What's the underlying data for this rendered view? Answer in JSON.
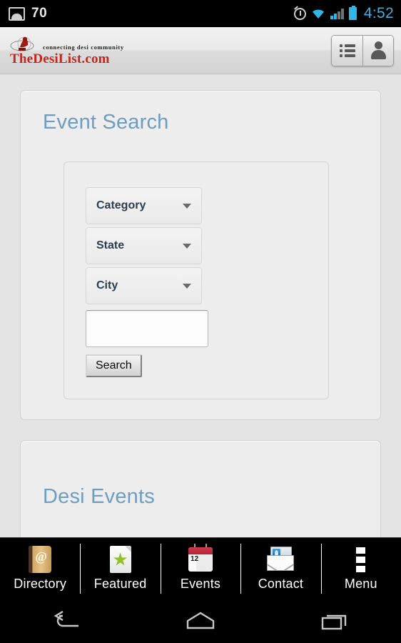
{
  "statusbar": {
    "notification_icon": "picture-icon",
    "notification_count": "70",
    "icons": [
      "alarm-icon",
      "wifi-icon",
      "signal-icon",
      "battery-icon"
    ],
    "time": "4:52",
    "accent_color": "#3eb0e0",
    "background": "#000000"
  },
  "appheader": {
    "logo_icon": "desilist-globe-logo",
    "tagline": "connecting desi community",
    "brand": "TheDesiList.com",
    "brand_color": "#c0271f",
    "buttons": [
      {
        "name": "list-menu-button",
        "icon": "list-icon"
      },
      {
        "name": "account-button",
        "icon": "person-icon"
      }
    ]
  },
  "main": {
    "search_panel": {
      "title": "Event Search",
      "title_color": "#6f9dc0",
      "fields": [
        {
          "name": "category-select",
          "label": "Category",
          "icon": "chevron-down-icon"
        },
        {
          "name": "state-select",
          "label": "State",
          "icon": "chevron-down-icon"
        },
        {
          "name": "city-select",
          "label": "City",
          "icon": "chevron-down-icon"
        }
      ],
      "keyword_input": {
        "value": "",
        "placeholder": ""
      },
      "submit_label": "Search"
    },
    "events_panel": {
      "title": "Desi Events"
    }
  },
  "tabbar": {
    "tabs": [
      {
        "label": "Directory",
        "icon": "address-book-icon"
      },
      {
        "label": "Featured",
        "icon": "star-page-icon"
      },
      {
        "label": "Events",
        "icon": "calendar-icon",
        "calendar_day": "12"
      },
      {
        "label": "Contact",
        "icon": "envelope-contact-icon"
      },
      {
        "label": "Menu",
        "icon": "overflow-menu-icon"
      }
    ]
  },
  "navbar": {
    "buttons": [
      {
        "name": "back-button",
        "icon": "back-arrow-icon"
      },
      {
        "name": "home-button",
        "icon": "home-icon"
      },
      {
        "name": "recents-button",
        "icon": "recents-icon"
      }
    ]
  }
}
